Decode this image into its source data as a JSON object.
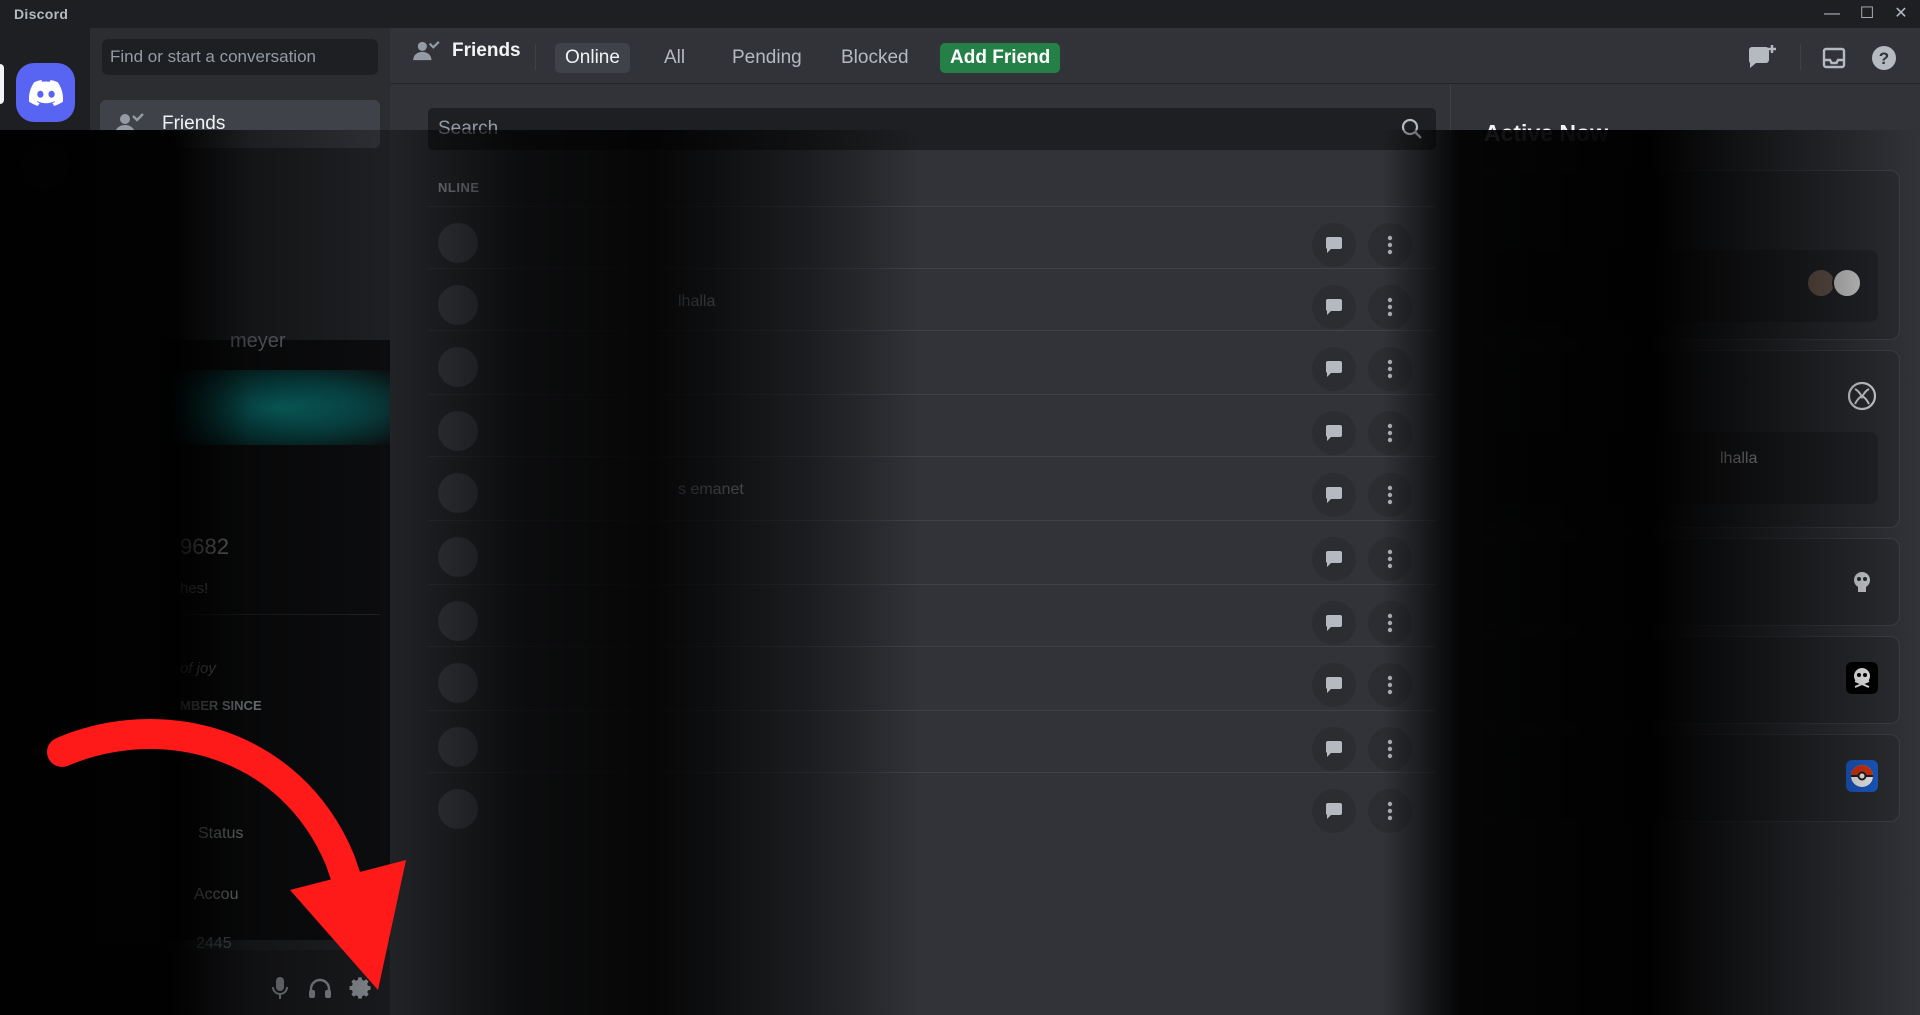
{
  "titlebar": {
    "app_name": "Discord",
    "minimize": "—",
    "maximize": "☐",
    "close": "✕"
  },
  "sidebar": {
    "find_placeholder": "Find or start a conversation",
    "friends_label": "Friends"
  },
  "profile_popout": {
    "name_partial": "meyer",
    "id_partial": "9682",
    "about_partial": "hes!",
    "quote_partial": "of joy",
    "member_since_partial": "MBER SINCE",
    "status_label_partial": "Status",
    "account_label_partial": "Accou"
  },
  "userbar": {
    "status_partial": "2445"
  },
  "topbar": {
    "friends_label": "Friends",
    "tabs": [
      {
        "label": "Online",
        "selected": true
      },
      {
        "label": "All"
      },
      {
        "label": "Pending"
      },
      {
        "label": "Blocked"
      },
      {
        "label": "Add Friend",
        "accent": "#248046"
      }
    ]
  },
  "search": {
    "placeholder": "Search"
  },
  "friends_list": {
    "section_label_partial": "NLINE",
    "rows": [
      {
        "sub": ""
      },
      {
        "sub": "lhalla"
      },
      {
        "sub": ""
      },
      {
        "sub": ""
      },
      {
        "sub": "s emanet"
      },
      {
        "sub": ""
      },
      {
        "sub": ""
      },
      {
        "sub": ""
      },
      {
        "sub": ""
      },
      {
        "sub": ""
      }
    ]
  },
  "active_now": {
    "title": "Active Now",
    "card2_text_partial": "lhalla"
  },
  "colors": {
    "brand": "#5865f2",
    "add_friend": "#248046",
    "annotation_arrow": "#ff1a1a"
  }
}
